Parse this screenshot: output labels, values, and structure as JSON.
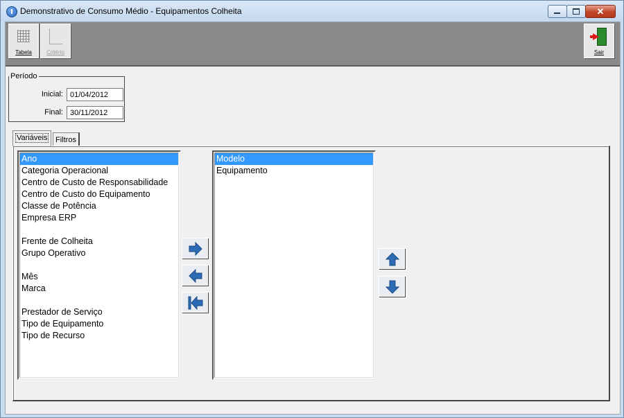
{
  "window": {
    "title": "Demonstrativo de Consumo Médio - Equipamentos Colheita",
    "close_glyph": "✕"
  },
  "toolbar": {
    "tabela_label": "Tabela",
    "criterio_label": "Critério",
    "sair_label": "Sair"
  },
  "periodo": {
    "legend": "Período",
    "inicial_label": "Inicial:",
    "inicial_value": "01/04/2012",
    "final_label": "Final:",
    "final_value": "30/11/2012"
  },
  "tabs": {
    "variaveis": "Variáveis",
    "filtros": "Filtros"
  },
  "available_list": {
    "items": [
      "Ano",
      "Categoria Operacional",
      "Centro de Custo de Responsabilidade",
      "Centro de Custo do Equipamento",
      "Classe de Potência",
      "Empresa ERP",
      "",
      "Frente de Colheita",
      "Grupo Operativo",
      "",
      "Mês",
      "Marca",
      "",
      "Prestador de Serviço",
      "Tipo de Equipamento",
      "Tipo de Recurso"
    ],
    "selected": "Ano"
  },
  "selected_list": {
    "items": [
      "Modelo",
      "Equipamento"
    ],
    "selected": "Modelo"
  },
  "icons": {
    "move_right": "arrow-right-icon",
    "move_left": "arrow-left-icon",
    "move_all_left": "arrow-first-icon",
    "move_up": "arrow-up-icon",
    "move_down": "arrow-down-icon"
  },
  "colors": {
    "selection": "#3399ff",
    "arrow": "#2e6bb5"
  }
}
